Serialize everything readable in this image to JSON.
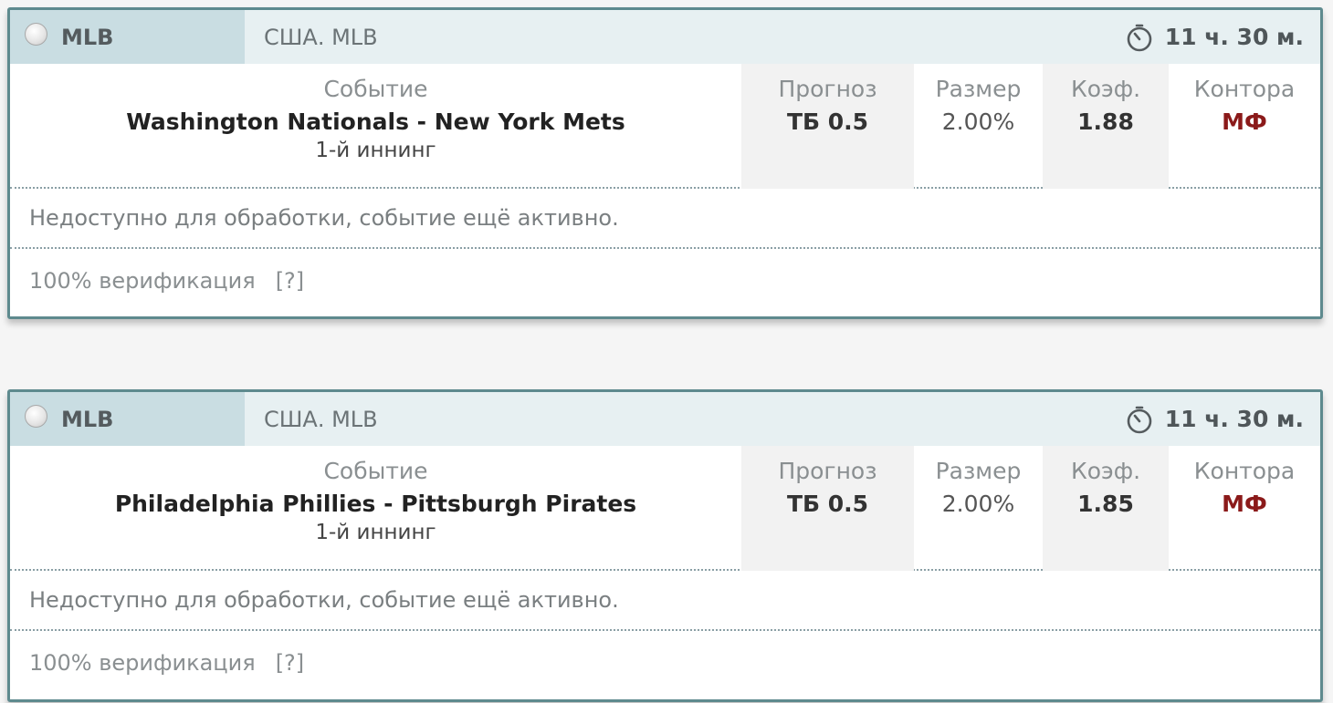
{
  "cards": [
    {
      "league": "MLB",
      "country": "США. MLB",
      "time": "11 ч. 30 м.",
      "headers": {
        "event": "Событие",
        "forecast": "Прогноз",
        "size": "Размер",
        "odds": "Коэф.",
        "bookie": "Контора"
      },
      "event": {
        "teams": "Washington Nationals - New York Mets",
        "period": "1-й иннинг"
      },
      "forecast": "ТБ 0.5",
      "size": "2.00%",
      "odds": "1.88",
      "bookie": "МФ",
      "note": "Недоступно для обработки, событие ещё активно.",
      "verification": "100% верификация",
      "help": "[?]"
    },
    {
      "league": "MLB",
      "country": "США. MLB",
      "time": "11 ч. 30 м.",
      "headers": {
        "event": "Событие",
        "forecast": "Прогноз",
        "size": "Размер",
        "odds": "Коэф.",
        "bookie": "Контора"
      },
      "event": {
        "teams": "Philadelphia Phillies - Pittsburgh Pirates",
        "period": "1-й иннинг"
      },
      "forecast": "ТБ 0.5",
      "size": "2.00%",
      "odds": "1.85",
      "bookie": "МФ",
      "note": "Недоступно для обработки, событие ещё активно.",
      "verification": "100% верификация",
      "help": "[?]"
    }
  ],
  "icons": {
    "status": "radio-icon",
    "time": "timer-icon"
  },
  "colors": {
    "border": "#5e8a8e",
    "header_bg": "#e7f0f2",
    "league_bg": "#c9dde2",
    "bookie_red": "#8b1a1a"
  }
}
